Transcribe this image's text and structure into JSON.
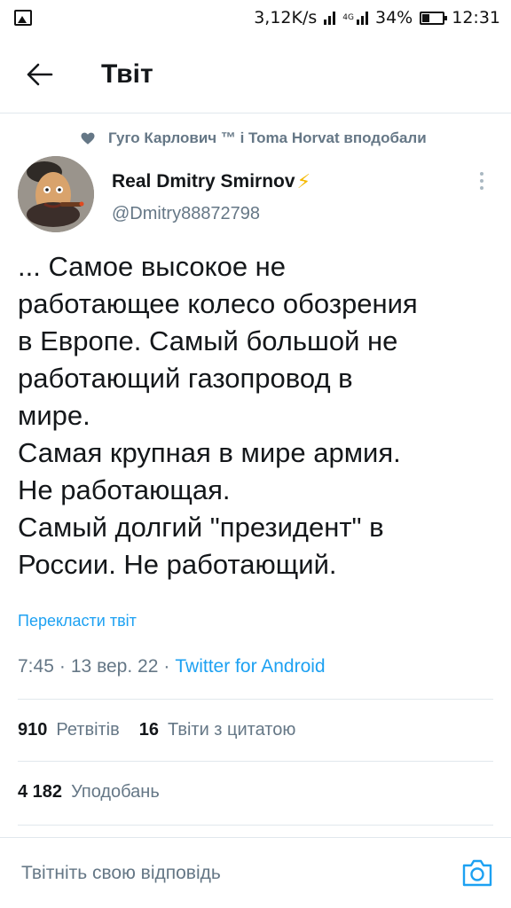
{
  "status_bar": {
    "speed": "3,12K/s",
    "network": "4G",
    "battery": "34%",
    "battery_level": 0.34,
    "time": "12:31"
  },
  "header": {
    "title": "Твіт"
  },
  "social_context": {
    "text": "Гуго Карлович ™ і Toma Horvat вподобали"
  },
  "author": {
    "name": "Real Dmitry Smirnov",
    "badge": "⚡",
    "handle": "@Dmitry88872798"
  },
  "tweet": {
    "lines": [
      "... Самое высокое не",
      "работающее колесо обозрения",
      "в Европе. Самый большой не",
      "работающий газопровод в",
      "мире.",
      "Самая крупная в мире армия.",
      "Не работающая.",
      "Самый долгий \"президент\" в",
      "России. Не работающий."
    ],
    "translate_label": "Перекласти твіт",
    "time": "7:45",
    "date": "13 вер. 22",
    "separator": "·",
    "client": "Twitter for Android"
  },
  "stats": {
    "retweets_count": "910",
    "retweets_label": "Ретвітів",
    "quotes_count": "16",
    "quotes_label": "Твіти з цитатою",
    "likes_count": "4 182",
    "likes_label": "Уподобань"
  },
  "reply": {
    "placeholder": "Твітніть свою відповідь"
  },
  "colors": {
    "accent": "#1da1f2",
    "secondary_text": "#657786",
    "divider": "#e1e8ed",
    "bolt": "#f5b800"
  }
}
